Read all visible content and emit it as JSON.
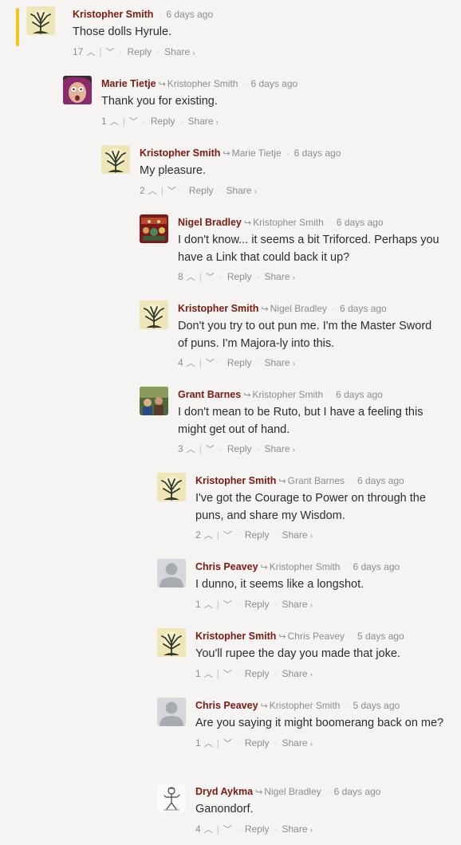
{
  "labels": {
    "reply": "Reply",
    "share": "Share",
    "share_chevron": "›",
    "upvote_glyph": "^",
    "downvote_glyph": "v",
    "reply_to_glyph": "↪",
    "dot": "·"
  },
  "colors": {
    "author": "#7a1a12",
    "highlight": "#f5c518",
    "muted": "#8a8d91"
  },
  "comments": [
    {
      "author": "Kristopher Smith",
      "parent": "",
      "time": "6 days ago",
      "text": "Those dolls Hyrule.",
      "votes": "17",
      "avatar": "tree-avatar-icon",
      "highlighted": true
    },
    {
      "author": "Marie Tietje",
      "parent": "Kristopher Smith",
      "time": "6 days ago",
      "text": "Thank you for existing.",
      "votes": "1",
      "avatar": "face-avatar-icon"
    },
    {
      "author": "Kristopher Smith",
      "parent": "Marie Tietje",
      "time": "6 days ago",
      "text": "My pleasure.",
      "votes": "2",
      "avatar": "tree-avatar-icon"
    },
    {
      "author": "Nigel Bradley",
      "parent": "Kristopher Smith",
      "time": "6 days ago",
      "text": "I don't know... it seems a bit Triforced. Perhaps you have a Link that could back it up?",
      "votes": "8",
      "avatar": "album-avatar-icon"
    },
    {
      "author": "Kristopher Smith",
      "parent": "Nigel Bradley",
      "time": "6 days ago",
      "text": "Don't you try to out pun me. I'm the Master Sword of puns. I'm Majora-ly into this.",
      "votes": "4",
      "avatar": "tree-avatar-icon"
    },
    {
      "author": "Grant Barnes",
      "parent": "Kristopher Smith",
      "time": "6 days ago",
      "text": "I don't mean to be Ruto, but I have a feeling this might get out of hand.",
      "votes": "3",
      "avatar": "photo-avatar-icon"
    },
    {
      "author": "Kristopher Smith",
      "parent": "Grant Barnes",
      "time": "6 days ago",
      "text": "I've got the Courage to Power on through the puns, and share my Wisdom.",
      "votes": "2",
      "avatar": "tree-avatar-icon"
    },
    {
      "author": "Chris Peavey",
      "parent": "Kristopher Smith",
      "time": "6 days ago",
      "text": "I dunno, it seems like a longshot.",
      "votes": "1",
      "avatar": "default-user-avatar-icon"
    },
    {
      "author": "Kristopher Smith",
      "parent": "Chris Peavey",
      "time": "5 days ago",
      "text": "You'll rupee the day you made that joke.",
      "votes": "1",
      "avatar": "tree-avatar-icon"
    },
    {
      "author": "Chris Peavey",
      "parent": "Kristopher Smith",
      "time": "5 days ago",
      "text": "Are you saying it might boomerang back on me?",
      "votes": "1",
      "avatar": "default-user-avatar-icon"
    },
    {
      "author": "Dryd Aykma",
      "parent": "Nigel Bradley",
      "time": "6 days ago",
      "text": "Ganondorf.",
      "votes": "4",
      "avatar": "sketch-avatar-icon"
    }
  ]
}
